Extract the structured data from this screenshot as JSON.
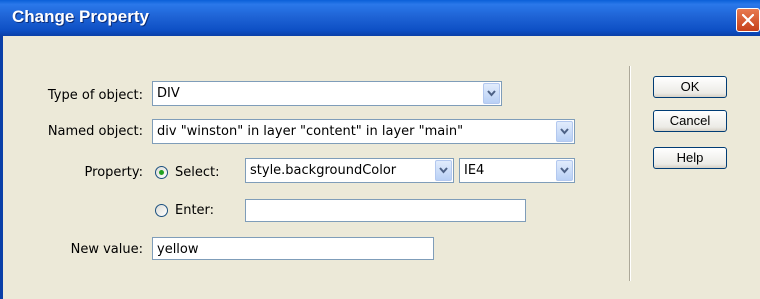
{
  "window": {
    "title": "Change Property"
  },
  "form": {
    "type_label": "Type of object:",
    "type_value": "DIV",
    "named_label": "Named object:",
    "named_value": "div \"winston\" in layer \"content\" in layer \"main\"",
    "property_label": "Property:",
    "select_label": "Select:",
    "property_select_value": "style.backgroundColor",
    "browser_select_value": "IE4",
    "enter_label": "Enter:",
    "enter_value": "",
    "new_value_label": "New value:",
    "new_value": "yellow",
    "property_mode": "select"
  },
  "buttons": {
    "ok": "OK",
    "cancel": "Cancel",
    "help": "Help"
  },
  "colors": {
    "titlebar": "#0a5fd8",
    "close": "#d9532a",
    "dialog_bg": "#ece9d8"
  }
}
